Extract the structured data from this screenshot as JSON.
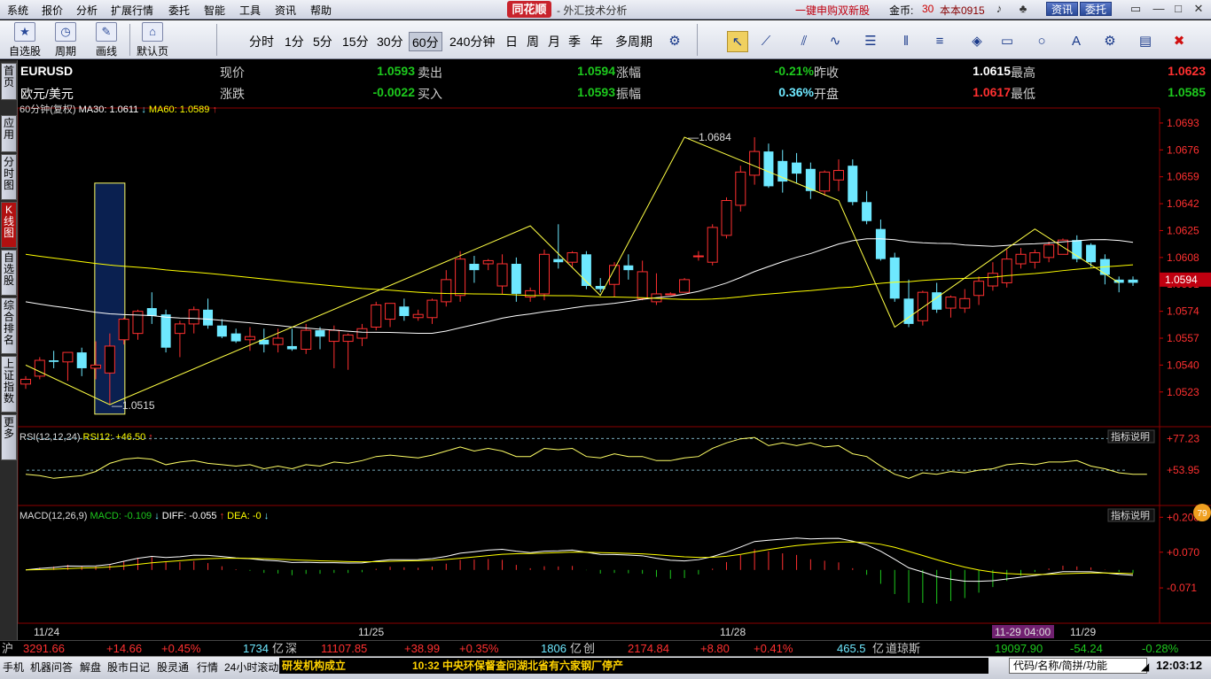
{
  "menu": {
    "items": [
      "系统",
      "报价",
      "分析",
      "扩展行情",
      "委托",
      "智能",
      "工具",
      "资讯",
      "帮助"
    ],
    "logo": "同花顺",
    "title": "- 外汇技术分析",
    "promo": "一键申购双新股",
    "coins_label": "金币:",
    "coins_value": "30",
    "account": "本本0915",
    "btn_news": "资讯",
    "btn_trade": "委托"
  },
  "toolbar": {
    "left": [
      {
        "label": "自选股",
        "icon": "star-icon"
      },
      {
        "label": "周期",
        "icon": "clock-icon"
      },
      {
        "label": "画线",
        "icon": "pencil-icon"
      },
      {
        "label": "默认页",
        "icon": "home-icon"
      }
    ],
    "periods": [
      "分时",
      "1分",
      "5分",
      "15分",
      "30分",
      "60分",
      "240分钟",
      "日",
      "周",
      "月",
      "季",
      "年",
      "多周期"
    ],
    "active_period": "60分"
  },
  "sidebar": [
    "首页",
    "应用",
    "分时图",
    "K线图",
    "自选股",
    "综合排名",
    "上证指数",
    "更多"
  ],
  "quote": {
    "symbol": "EURUSD",
    "name": "欧元/美元",
    "row1": [
      {
        "k": "现价",
        "v": "1.0593",
        "c": "#1dc81d"
      },
      {
        "k": "卖出",
        "v": "1.0594",
        "c": "#1dc81d"
      },
      {
        "k": "涨幅",
        "v": "-0.21%",
        "c": "#1dc81d"
      },
      {
        "k": "昨收",
        "v": "1.0615",
        "c": "#ffffff"
      },
      {
        "k": "最高",
        "v": "1.0623",
        "c": "#ff3030"
      }
    ],
    "row2": [
      {
        "k": "涨跌",
        "v": "-0.0022",
        "c": "#1dc81d"
      },
      {
        "k": "买入",
        "v": "1.0593",
        "c": "#1dc81d"
      },
      {
        "k": "振幅",
        "v": "0.36%",
        "c": "#6ee8ff"
      },
      {
        "k": "开盘",
        "v": "1.0617",
        "c": "#ff3030"
      },
      {
        "k": "最低",
        "v": "1.0585",
        "c": "#1dc81d"
      }
    ]
  },
  "chart_data": {
    "type": "candlestick",
    "period_label": "60分钟(复权)",
    "ma_legend": [
      {
        "name": "MA30",
        "value": "1.0611",
        "dir": "down",
        "color": "#ffffff"
      },
      {
        "name": "MA60",
        "value": "1.0589",
        "dir": "up",
        "color": "#ffff00"
      }
    ],
    "y_ticks": [
      "1.0693",
      "1.0676",
      "1.0659",
      "1.0642",
      "1.0625",
      "1.0608",
      "1.0591",
      "1.0574",
      "1.0557",
      "1.0540",
      "1.0523"
    ],
    "ylim": [
      1.051,
      1.0698
    ],
    "current_price_label": "1.0594",
    "annotations": [
      {
        "text": "1.0684",
        "value": 1.0684
      },
      {
        "text": "1.0515",
        "value": 1.0515
      }
    ],
    "x_labels": [
      "11/24",
      "11/25",
      "11/28",
      "11-29 04:00",
      "11/29"
    ],
    "candles": [
      {
        "o": 1.0528,
        "h": 1.0533,
        "l": 1.0525,
        "c": 1.0531
      },
      {
        "o": 1.0533,
        "h": 1.0545,
        "l": 1.0531,
        "c": 1.0543
      },
      {
        "o": 1.0543,
        "h": 1.0549,
        "l": 1.0538,
        "c": 1.0542
      },
      {
        "o": 1.0542,
        "h": 1.0548,
        "l": 1.053,
        "c": 1.0548
      },
      {
        "o": 1.0548,
        "h": 1.0551,
        "l": 1.0533,
        "c": 1.0538
      },
      {
        "o": 1.0538,
        "h": 1.0555,
        "l": 1.0531,
        "c": 1.054
      },
      {
        "o": 1.0535,
        "h": 1.056,
        "l": 1.0515,
        "c": 1.0552
      },
      {
        "o": 1.0556,
        "h": 1.057,
        "l": 1.0553,
        "c": 1.0569
      },
      {
        "o": 1.056,
        "h": 1.0575,
        "l": 1.0556,
        "c": 1.0574
      },
      {
        "o": 1.0576,
        "h": 1.0586,
        "l": 1.0566,
        "c": 1.0571
      },
      {
        "o": 1.0572,
        "h": 1.0575,
        "l": 1.0548,
        "c": 1.0551
      },
      {
        "o": 1.056,
        "h": 1.0568,
        "l": 1.0545,
        "c": 1.0566
      },
      {
        "o": 1.0566,
        "h": 1.0577,
        "l": 1.056,
        "c": 1.0575
      },
      {
        "o": 1.0575,
        "h": 1.0582,
        "l": 1.0563,
        "c": 1.0565
      },
      {
        "o": 1.0565,
        "h": 1.0569,
        "l": 1.0557,
        "c": 1.0558
      },
      {
        "o": 1.056,
        "h": 1.0563,
        "l": 1.0554,
        "c": 1.0555
      },
      {
        "o": 1.0556,
        "h": 1.0564,
        "l": 1.0549,
        "c": 1.0558
      },
      {
        "o": 1.0556,
        "h": 1.0563,
        "l": 1.0548,
        "c": 1.0553
      },
      {
        "o": 1.0553,
        "h": 1.0563,
        "l": 1.0548,
        "c": 1.0557
      },
      {
        "o": 1.0552,
        "h": 1.0563,
        "l": 1.0549,
        "c": 1.055
      },
      {
        "o": 1.055,
        "h": 1.0566,
        "l": 1.0547,
        "c": 1.0562
      },
      {
        "o": 1.0562,
        "h": 1.0564,
        "l": 1.055,
        "c": 1.0558
      },
      {
        "o": 1.0555,
        "h": 1.0565,
        "l": 1.0538,
        "c": 1.0562
      },
      {
        "o": 1.0555,
        "h": 1.056,
        "l": 1.0537,
        "c": 1.0559
      },
      {
        "o": 1.0557,
        "h": 1.0566,
        "l": 1.0552,
        "c": 1.0563
      },
      {
        "o": 1.0564,
        "h": 1.058,
        "l": 1.0562,
        "c": 1.0578
      },
      {
        "o": 1.0569,
        "h": 1.0578,
        "l": 1.0564,
        "c": 1.0579
      },
      {
        "o": 1.0577,
        "h": 1.0582,
        "l": 1.0568,
        "c": 1.0571
      },
      {
        "o": 1.057,
        "h": 1.0575,
        "l": 1.0568,
        "c": 1.0572
      },
      {
        "o": 1.057,
        "h": 1.0582,
        "l": 1.0566,
        "c": 1.0581
      },
      {
        "o": 1.058,
        "h": 1.06,
        "l": 1.0577,
        "c": 1.0594
      },
      {
        "o": 1.0584,
        "h": 1.0612,
        "l": 1.058,
        "c": 1.0607
      },
      {
        "o": 1.0604,
        "h": 1.0609,
        "l": 1.0592,
        "c": 1.06
      },
      {
        "o": 1.0604,
        "h": 1.0607,
        "l": 1.06,
        "c": 1.0606
      },
      {
        "o": 1.059,
        "h": 1.061,
        "l": 1.0585,
        "c": 1.0604
      },
      {
        "o": 1.0604,
        "h": 1.0608,
        "l": 1.058,
        "c": 1.0585
      },
      {
        "o": 1.0583,
        "h": 1.0589,
        "l": 1.058,
        "c": 1.0587
      },
      {
        "o": 1.0585,
        "h": 1.0613,
        "l": 1.0581,
        "c": 1.061
      },
      {
        "o": 1.0607,
        "h": 1.0629,
        "l": 1.0601,
        "c": 1.0605
      },
      {
        "o": 1.0605,
        "h": 1.0612,
        "l": 1.0602,
        "c": 1.0611
      },
      {
        "o": 1.061,
        "h": 1.0612,
        "l": 1.0588,
        "c": 1.059
      },
      {
        "o": 1.059,
        "h": 1.0595,
        "l": 1.0586,
        "c": 1.0588
      },
      {
        "o": 1.0591,
        "h": 1.0605,
        "l": 1.0583,
        "c": 1.0603
      },
      {
        "o": 1.0603,
        "h": 1.061,
        "l": 1.0594,
        "c": 1.06
      },
      {
        "o": 1.0582,
        "h": 1.0606,
        "l": 1.0581,
        "c": 1.0599
      },
      {
        "o": 1.058,
        "h": 1.0598,
        "l": 1.0578,
        "c": 1.0585
      },
      {
        "o": 1.0585,
        "h": 1.0586,
        "l": 1.0585,
        "c": 1.0585
      },
      {
        "o": 1.0586,
        "h": 1.0595,
        "l": 1.0586,
        "c": 1.0594
      },
      {
        "o": 1.0609,
        "h": 1.0612,
        "l": 1.0606,
        "c": 1.0609
      },
      {
        "o": 1.0605,
        "h": 1.0629,
        "l": 1.0603,
        "c": 1.0627
      },
      {
        "o": 1.0622,
        "h": 1.0646,
        "l": 1.062,
        "c": 1.0644
      },
      {
        "o": 1.0641,
        "h": 1.0666,
        "l": 1.0637,
        "c": 1.0662
      },
      {
        "o": 1.066,
        "h": 1.0684,
        "l": 1.0654,
        "c": 1.0675
      },
      {
        "o": 1.0675,
        "h": 1.068,
        "l": 1.0652,
        "c": 1.0653
      },
      {
        "o": 1.0669,
        "h": 1.0676,
        "l": 1.0649,
        "c": 1.0656
      },
      {
        "o": 1.0668,
        "h": 1.0674,
        "l": 1.0655,
        "c": 1.0661
      },
      {
        "o": 1.0664,
        "h": 1.0668,
        "l": 1.0645,
        "c": 1.065
      },
      {
        "o": 1.065,
        "h": 1.0663,
        "l": 1.0647,
        "c": 1.0662
      },
      {
        "o": 1.0657,
        "h": 1.067,
        "l": 1.065,
        "c": 1.0663
      },
      {
        "o": 1.0666,
        "h": 1.067,
        "l": 1.0641,
        "c": 1.0643
      },
      {
        "o": 1.0643,
        "h": 1.065,
        "l": 1.0629,
        "c": 1.0631
      },
      {
        "o": 1.0626,
        "h": 1.0632,
        "l": 1.0606,
        "c": 1.0607
      },
      {
        "o": 1.0608,
        "h": 1.0611,
        "l": 1.058,
        "c": 1.0582
      },
      {
        "o": 1.0582,
        "h": 1.0594,
        "l": 1.0564,
        "c": 1.0566
      },
      {
        "o": 1.0568,
        "h": 1.0587,
        "l": 1.0565,
        "c": 1.0586
      },
      {
        "o": 1.0586,
        "h": 1.0592,
        "l": 1.0573,
        "c": 1.0575
      },
      {
        "o": 1.0576,
        "h": 1.0584,
        "l": 1.057,
        "c": 1.0583
      },
      {
        "o": 1.0576,
        "h": 1.0588,
        "l": 1.0573,
        "c": 1.0582
      },
      {
        "o": 1.0584,
        "h": 1.0596,
        "l": 1.0578,
        "c": 1.0593
      },
      {
        "o": 1.059,
        "h": 1.0605,
        "l": 1.0587,
        "c": 1.0598
      },
      {
        "o": 1.0592,
        "h": 1.0613,
        "l": 1.0589,
        "c": 1.0607
      },
      {
        "o": 1.0604,
        "h": 1.0614,
        "l": 1.0601,
        "c": 1.061
      },
      {
        "o": 1.0605,
        "h": 1.0613,
        "l": 1.0601,
        "c": 1.0611
      },
      {
        "o": 1.0608,
        "h": 1.0618,
        "l": 1.0605,
        "c": 1.0616
      },
      {
        "o": 1.061,
        "h": 1.062,
        "l": 1.061,
        "c": 1.0619
      },
      {
        "o": 1.0619,
        "h": 1.0622,
        "l": 1.0605,
        "c": 1.0607
      },
      {
        "o": 1.0616,
        "h": 1.0617,
        "l": 1.0602,
        "c": 1.0605
      },
      {
        "o": 1.0607,
        "h": 1.061,
        "l": 1.0591,
        "c": 1.0597
      },
      {
        "o": 1.0594,
        "h": 1.0596,
        "l": 1.0586,
        "c": 1.0592
      },
      {
        "o": 1.0594,
        "h": 1.0596,
        "l": 1.059,
        "c": 1.0592
      }
    ],
    "rsi": {
      "label": "RSI(12,12,24)",
      "legend": "RSI12:",
      "value": "+46.50",
      "dir": "up",
      "ticks": [
        "+77.23",
        "+53.95"
      ],
      "ylim": [
        30,
        82
      ],
      "values": [
        51,
        50,
        48,
        49,
        50,
        53,
        59,
        62,
        63,
        62,
        58,
        60,
        61,
        59,
        58,
        57,
        58,
        55,
        57,
        55,
        58,
        57,
        60,
        59,
        61,
        64,
        65,
        64,
        63,
        65,
        68,
        71,
        68,
        70,
        68,
        64,
        64,
        70,
        69,
        70,
        64,
        63,
        66,
        64,
        64,
        61,
        61,
        63,
        64,
        70,
        74,
        77,
        78,
        72,
        74,
        72,
        74,
        71,
        72,
        66,
        64,
        57,
        51,
        48,
        52,
        51,
        53,
        52,
        54,
        55,
        58,
        59,
        58,
        60,
        60,
        61,
        57,
        55,
        52,
        51,
        51
      ]
    },
    "macd": {
      "label": "MACD(12,26,9)",
      "legend": [
        {
          "name": "MACD:",
          "value": "-0.109",
          "dir": "down",
          "color": "#1dc81d"
        },
        {
          "name": "DIFF:",
          "value": "-0.055",
          "dir": "up",
          "color": "#ffffff"
        },
        {
          "name": "DEA:",
          "value": "-0",
          "dir": "down",
          "color": "#ffff00"
        }
      ],
      "ticks": [
        "+0.208",
        "+0.070",
        "-0.071"
      ],
      "ylim": [
        -0.2,
        0.23
      ],
      "hint": "指标说明",
      "side_badge": "79"
    }
  },
  "status": {
    "sh_label": "沪",
    "sh_idx": "3291.66",
    "sh_chg": "+14.66",
    "sh_pct": "+0.45%",
    "sh_vol": "1734",
    "sh_unit": "亿",
    "sz_label": "深",
    "sz_idx": "11107.85",
    "sz_chg": "+38.99",
    "sz_pct": "+0.35%",
    "sz_vol": "1806",
    "sz_unit": "亿",
    "cy_label": "创",
    "cy_idx": "2174.84",
    "cy_chg": "+8.80",
    "cy_pct": "+0.41%",
    "cy_vol": "465.5",
    "cy_unit": "亿",
    "dj_label": "道琼斯",
    "dj_idx": "19097.90",
    "dj_chg": "-54.24",
    "dj_pct": "-0.28%"
  },
  "bottom": {
    "items": [
      "手机",
      "机器问答",
      "解盘",
      "股市日记",
      "股灵通",
      "行情",
      "24小时滚动"
    ],
    "news1": "研发机构成立",
    "news2": "10:32 中央环保督查问湖北省有六家钢厂停产",
    "search_placeholder": "代码/名称/简拼/功能",
    "clock": "12:03:12"
  }
}
